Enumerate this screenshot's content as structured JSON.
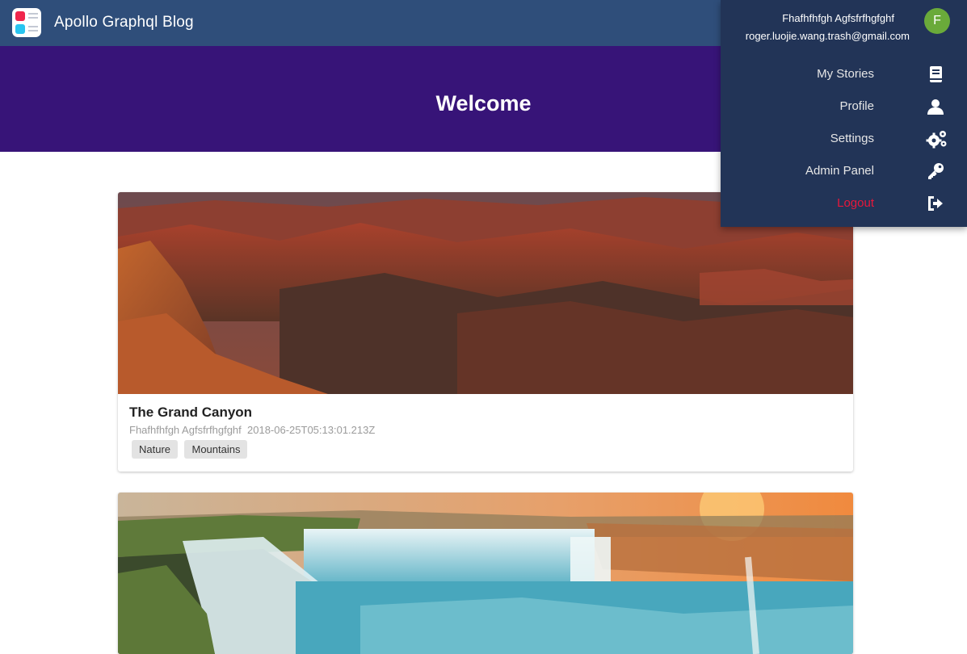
{
  "app": {
    "title": "Apollo Graphql Blog",
    "logo_icon": "app-logo-icon",
    "bar_color": "#2f4e7a"
  },
  "hero": {
    "title": "Welcome",
    "color": "#371478"
  },
  "stories": [
    {
      "image": "grand-canyon-photo",
      "title": "The Grand Canyon",
      "author": "Fhafhfhfgh Agfsfrfhgfghf",
      "date": "2018-06-25T05:13:01.213Z",
      "tags": [
        "Nature",
        "Mountains"
      ]
    },
    {
      "image": "waterfall-sunset-photo"
    }
  ],
  "user_menu": {
    "name": "Fhafhfhfgh Agfsfrfhgfghf",
    "email": "roger.luojie.wang.trash@gmail.com",
    "avatar_initial": "F",
    "avatar_color": "#6aaa3a",
    "items": [
      {
        "label": "My Stories",
        "icon": "book-icon"
      },
      {
        "label": "Profile",
        "icon": "user-icon"
      },
      {
        "label": "Settings",
        "icon": "gears-icon"
      },
      {
        "label": "Admin Panel",
        "icon": "key-icon"
      },
      {
        "label": "Logout",
        "icon": "sign-out-icon",
        "color": "#e8173b"
      }
    ]
  }
}
